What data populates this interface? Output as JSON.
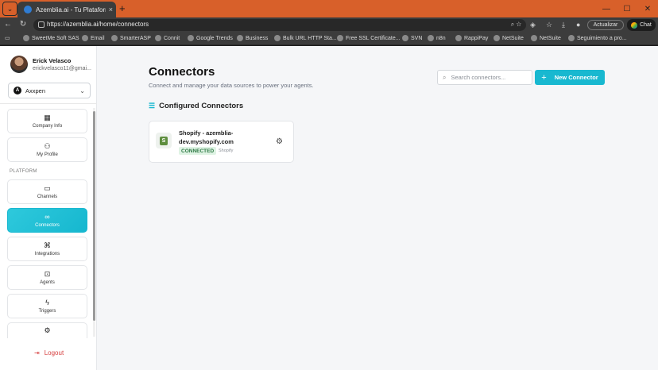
{
  "browser": {
    "tab_title": "Azembliа.ai - Tu Plataforma de Ap",
    "tab_close": "×",
    "new_tab": "+",
    "url": "https://azemblia.ai/home/connectors",
    "update_label": "Actualizar",
    "chat_label": "Chat",
    "bookmarks": [
      {
        "label": "SweetMe Soft SAS"
      },
      {
        "label": "Email"
      },
      {
        "label": "SmarterASP"
      },
      {
        "label": "Connit"
      },
      {
        "label": "Google Trends"
      },
      {
        "label": "Business"
      },
      {
        "label": "Bulk URL HTTP Sta..."
      },
      {
        "label": "Free SSL Certificate..."
      },
      {
        "label": "SVN"
      },
      {
        "label": "n8n"
      },
      {
        "label": "RappiPay"
      },
      {
        "label": "NetSuite"
      },
      {
        "label": "NetSuite"
      },
      {
        "label": "Seguimiento a pro..."
      }
    ]
  },
  "sidebar": {
    "user_name": "Erick Velasco",
    "user_email": "erickvelasco11@gmai...",
    "org_name": "Axxpen",
    "org_initial": "A",
    "section_label": "PLATFORM",
    "items": [
      {
        "label": "Company Info",
        "icon": "building-icon"
      },
      {
        "label": "My Profile",
        "icon": "user-icon"
      },
      {
        "label": "Channels",
        "icon": "message-icon"
      },
      {
        "label": "Connectors",
        "icon": "link-icon"
      },
      {
        "label": "Integrations",
        "icon": "network-icon"
      },
      {
        "label": "Agents",
        "icon": "bot-icon"
      },
      {
        "label": "Triggers",
        "icon": "zap-icon"
      },
      {
        "label": "",
        "icon": "gear-icon"
      }
    ],
    "logout_label": "Logout"
  },
  "main": {
    "title": "Connectors",
    "subtitle": "Connect and manage your data sources to power your agents.",
    "search_placeholder": "Search connectors...",
    "new_button_label": "New Connector",
    "section_title": "Configured Connectors",
    "connectors": [
      {
        "name": "Shopify - azemblia-dev.myshopify.com",
        "status": "CONNECTED",
        "type": "Shopify"
      }
    ]
  },
  "colors": {
    "accent": "#18b8d0",
    "titlebar": "#d8602a",
    "status_bg": "#dff3e4",
    "status_text": "#2f7a45",
    "logout": "#d64040"
  }
}
